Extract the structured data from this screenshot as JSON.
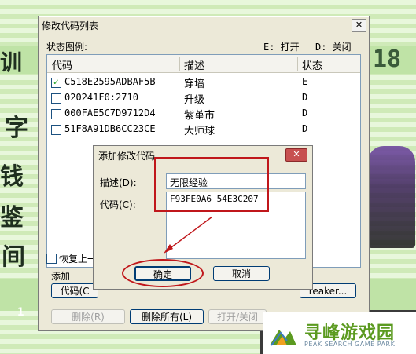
{
  "background": {
    "fragments": [
      "训",
      "字",
      "钱",
      "鉴",
      "间",
      "18",
      "1"
    ]
  },
  "window": {
    "title": "修改代码列表",
    "close": "✕",
    "legend": {
      "label": "状态图例:",
      "on": "E: 打开",
      "off": "D: 关闭"
    },
    "columns": [
      "代码",
      "描述",
      "状态"
    ],
    "rows": [
      {
        "checked": true,
        "code": "C518E2595ADBAF5B",
        "desc": "穿墙",
        "state": "E"
      },
      {
        "checked": false,
        "code": "020241F0:2710",
        "desc": "升级",
        "state": "D"
      },
      {
        "checked": false,
        "code": "000FAE5C7D9712D4",
        "desc": "紫堇市",
        "state": "D"
      },
      {
        "checked": false,
        "code": "51F8A91DB6CC23CE",
        "desc": "大师球",
        "state": "D"
      }
    ],
    "restore_label": "恢复上一",
    "add_group_label": "添加",
    "code_button": "代码(C",
    "remove_button": "删除(R)",
    "remove_all_button": "删除所有(L)",
    "toggle_button": "打开/关闭",
    "breaker_button": "reaker..."
  },
  "dialog": {
    "title": "添加修改代码",
    "close": "✕",
    "desc_label": "描述(D):",
    "desc_value": "无限经验",
    "code_label": "代码(C):",
    "code_value": "F93FE0A6 54E3C207",
    "ok_button": "确定",
    "cancel_button": "取消"
  },
  "watermark": {
    "title": "寻峰游戏园",
    "subtitle": "PEAK SEARCH GAME PARK"
  },
  "colors": {
    "highlight": "#c0171b",
    "accent": "#5b9a20"
  }
}
